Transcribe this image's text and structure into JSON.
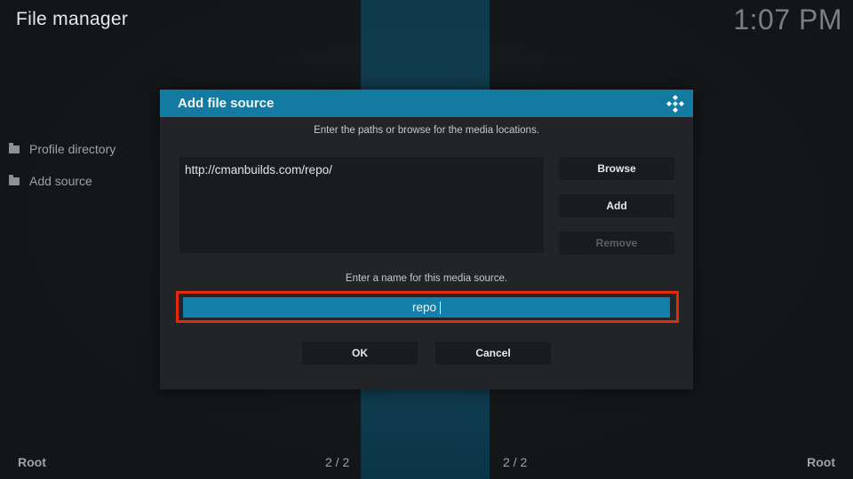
{
  "app": {
    "title": "File manager",
    "clock": "1:07 PM"
  },
  "sidebar": {
    "items": [
      {
        "label": "Profile directory",
        "icon": "folder-icon"
      },
      {
        "label": "Add source",
        "icon": "folder-icon"
      }
    ]
  },
  "footer": {
    "left_label": "Root",
    "right_label": "Root",
    "left_count": "2 / 2",
    "right_count": "2 / 2"
  },
  "dialog": {
    "title": "Add file source",
    "logo_icon": "kodi-logo-icon",
    "paths_instruction": "Enter the paths or browse for the media locations.",
    "paths": [
      "http://cmanbuilds.com/repo/"
    ],
    "buttons": {
      "browse": "Browse",
      "add": "Add",
      "remove": "Remove"
    },
    "name_instruction": "Enter a name for this media source.",
    "name_value": "repo",
    "ok": "OK",
    "cancel": "Cancel"
  },
  "colors": {
    "accent": "#137aa1",
    "highlight_border": "#e22a0c",
    "background": "#131517",
    "dialog_bg": "#222427"
  }
}
